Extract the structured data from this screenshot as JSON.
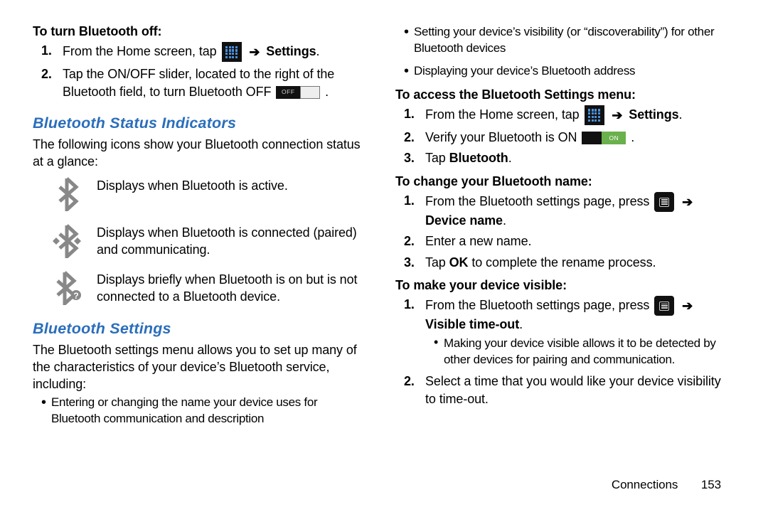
{
  "left": {
    "turnOffHead": "To turn Bluetooth off:",
    "step1_a": "From the Home screen, tap ",
    "step1_b": "Settings",
    "step2_a": "Tap the ON/OFF slider, located to the right of the Bluetooth field, to turn Bluetooth OFF ",
    "offLabel": "OFF",
    "subIndicators": "Bluetooth Status Indicators",
    "indicatorsIntro": "The following icons show your Bluetooth connection status at a glance:",
    "bt1": "Displays when Bluetooth is active.",
    "bt2": "Displays when Bluetooth is connected (paired) and communicating.",
    "bt3": "Displays briefly when Bluetooth is on but is not connected to a Bluetooth device.",
    "subSettings": "Bluetooth Settings",
    "settingsIntro": "The Bluetooth settings menu allows you to set up many of the characteristics of your device’s Bluetooth service, including:",
    "bullet1": "Entering or changing the name your device uses for Bluetooth communication and description"
  },
  "right": {
    "bullet2": "Setting your device’s visibility (or “discoverability”) for other Bluetooth devices",
    "bullet3": "Displaying your device’s Bluetooth address",
    "accessHead": "To access the Bluetooth Settings menu:",
    "a_step1_a": "From the Home screen, tap ",
    "a_step1_b": "Settings",
    "a_step2_a": "Verify your Bluetooth is ON ",
    "onLabel": "ON",
    "a_step3_a": "Tap ",
    "a_step3_b": "Bluetooth",
    "nameHead": "To change your Bluetooth name:",
    "n_step1_a": "From the Bluetooth settings page, press ",
    "n_step1_b": "Device name",
    "n_step2": "Enter a new name.",
    "n_step3_a": "Tap ",
    "n_step3_b": "OK",
    "n_step3_c": " to complete the rename process.",
    "visHead": "To make your device visible:",
    "v_step1_a": "From the Bluetooth settings page, press ",
    "v_step1_b": "Visible time-out",
    "v_sub": "Making your device visible allows it to be detected by other devices for pairing and communication.",
    "v_step2": "Select a time that you would like your device visibility to time-out."
  },
  "arrow": "➔",
  "footer": {
    "section": "Connections",
    "page": "153"
  }
}
